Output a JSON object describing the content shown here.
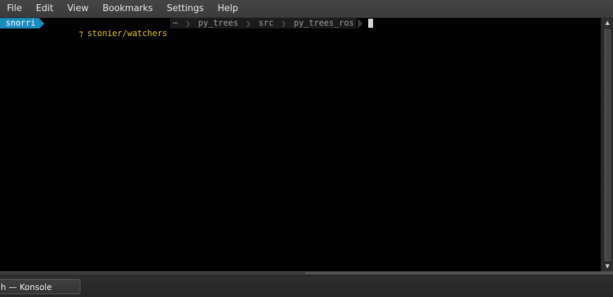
{
  "menubar": {
    "items": [
      {
        "label": "File"
      },
      {
        "label": "Edit"
      },
      {
        "label": "View"
      },
      {
        "label": "Bookmarks"
      },
      {
        "label": "Settings"
      },
      {
        "label": "Help"
      }
    ]
  },
  "prompt": {
    "user": "snorri",
    "repo_icon": "⁊",
    "repo": "stonier/watchers",
    "ellipsis": "⋯",
    "path": [
      "py_trees",
      "src",
      "py_trees_ros"
    ]
  },
  "taskbar": {
    "window_label": "h — Konsole"
  },
  "icons": {
    "scroll_up": "scroll-up-arrow-icon",
    "scroll_down": "scroll-down-arrow-icon"
  },
  "colors": {
    "user_segment": "#1a8cbf",
    "repo_text": "#e6c61a",
    "path_text": "#9a9a9a"
  }
}
